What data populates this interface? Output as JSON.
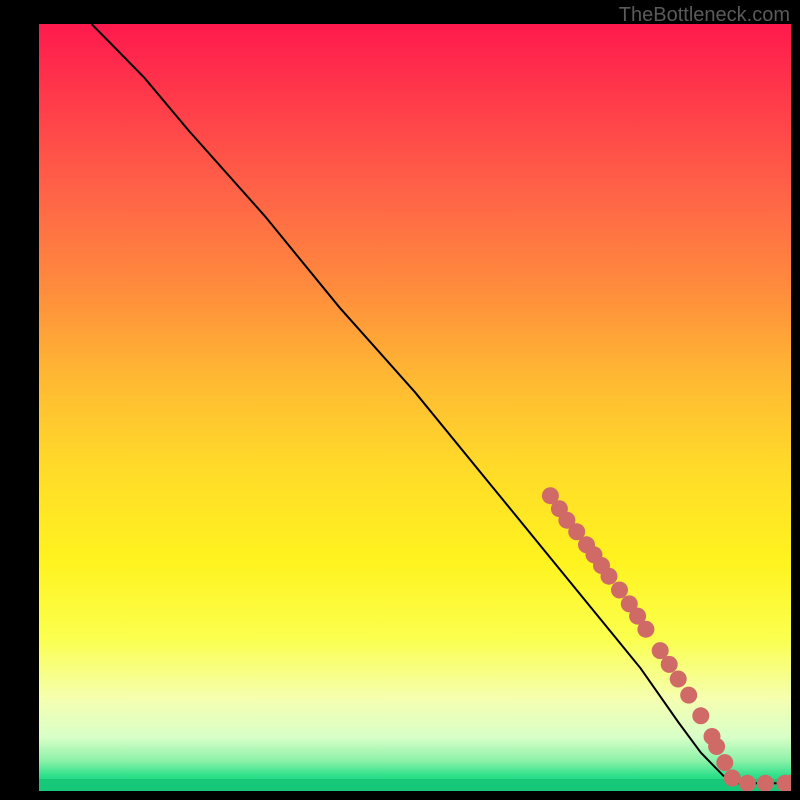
{
  "watermark": "TheBottleneck.com",
  "chart_data": {
    "type": "line",
    "title": "",
    "xlabel": "",
    "ylabel": "",
    "xlim": [
      0,
      100
    ],
    "ylim": [
      0,
      100
    ],
    "series": [
      {
        "name": "curve",
        "x": [
          7,
          10,
          14,
          20,
          30,
          40,
          50,
          60,
          70,
          80,
          85,
          88,
          91,
          93,
          96,
          100
        ],
        "y": [
          100,
          97,
          93,
          86,
          75,
          63,
          52,
          40,
          28,
          16,
          9,
          5,
          2,
          1,
          1,
          1
        ]
      }
    ],
    "markers": [
      {
        "x": 68.0,
        "y": 38.5
      },
      {
        "x": 69.2,
        "y": 36.8
      },
      {
        "x": 70.2,
        "y": 35.3
      },
      {
        "x": 71.5,
        "y": 33.8
      },
      {
        "x": 72.8,
        "y": 32.1
      },
      {
        "x": 73.8,
        "y": 30.8
      },
      {
        "x": 74.8,
        "y": 29.4
      },
      {
        "x": 75.8,
        "y": 28.0
      },
      {
        "x": 77.2,
        "y": 26.2
      },
      {
        "x": 78.5,
        "y": 24.4
      },
      {
        "x": 79.6,
        "y": 22.8
      },
      {
        "x": 80.7,
        "y": 21.1
      },
      {
        "x": 82.6,
        "y": 18.3
      },
      {
        "x": 83.8,
        "y": 16.5
      },
      {
        "x": 85.0,
        "y": 14.6
      },
      {
        "x": 86.4,
        "y": 12.5
      },
      {
        "x": 88.0,
        "y": 9.8
      },
      {
        "x": 89.5,
        "y": 7.1
      },
      {
        "x": 90.1,
        "y": 5.8
      },
      {
        "x": 91.2,
        "y": 3.7
      },
      {
        "x": 92.2,
        "y": 1.7
      },
      {
        "x": 94.2,
        "y": 1.0
      },
      {
        "x": 96.6,
        "y": 1.0
      },
      {
        "x": 99.2,
        "y": 1.0
      },
      {
        "x": 100.0,
        "y": 1.0
      }
    ],
    "gradient_stops": [
      {
        "pos": 0.0,
        "color": "#ff1a4d"
      },
      {
        "pos": 0.5,
        "color": "#ffd21f"
      },
      {
        "pos": 0.82,
        "color": "#fbff4d"
      },
      {
        "pos": 0.94,
        "color": "#b8ffc8"
      },
      {
        "pos": 1.0,
        "color": "#16c877"
      }
    ],
    "marker_color": "#cf6a66"
  }
}
